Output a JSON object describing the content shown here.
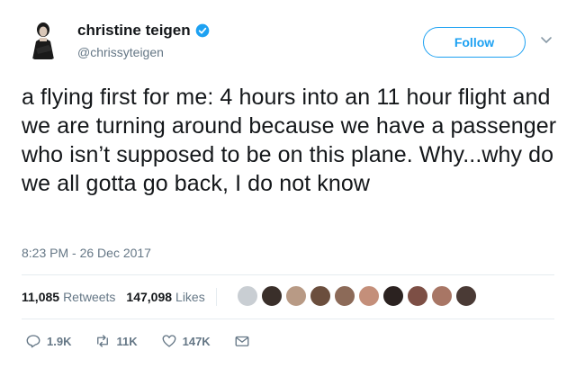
{
  "author": {
    "name": "christine teigen",
    "handle": "@chrissyteigen",
    "verified_color": "#1da1f2"
  },
  "follow_label": "Follow",
  "tweet": {
    "text": "a flying first for me: 4 hours into an 11 hour flight and we are turning around because we have a passenger who isn’t supposed to be on this plane. Why...why do we all gotta go back, I do not know",
    "timestamp": "8:23 PM - 26 Dec 2017"
  },
  "stats": {
    "retweets_count": "11,085",
    "retweets_label": "Retweets",
    "likes_count": "147,098",
    "likes_label": "Likes"
  },
  "likers": [
    "#c9ced3",
    "#3a2f2a",
    "#b89a85",
    "#6b4e3d",
    "#8c6a58",
    "#c48f7a",
    "#2b2220",
    "#7d4f45",
    "#a87665",
    "#4a3a35"
  ],
  "actions": {
    "reply_count": "1.9K",
    "retweet_count": "11K",
    "like_count": "147K"
  },
  "icons": {
    "reply": "reply-icon",
    "retweet": "retweet-icon",
    "like": "heart-icon",
    "dm": "envelope-icon",
    "caret": "chevron-down-icon",
    "verified": "verified-badge-icon"
  },
  "colors": {
    "accent": "#1da1f2",
    "muted": "#657786",
    "text": "#14171a"
  }
}
